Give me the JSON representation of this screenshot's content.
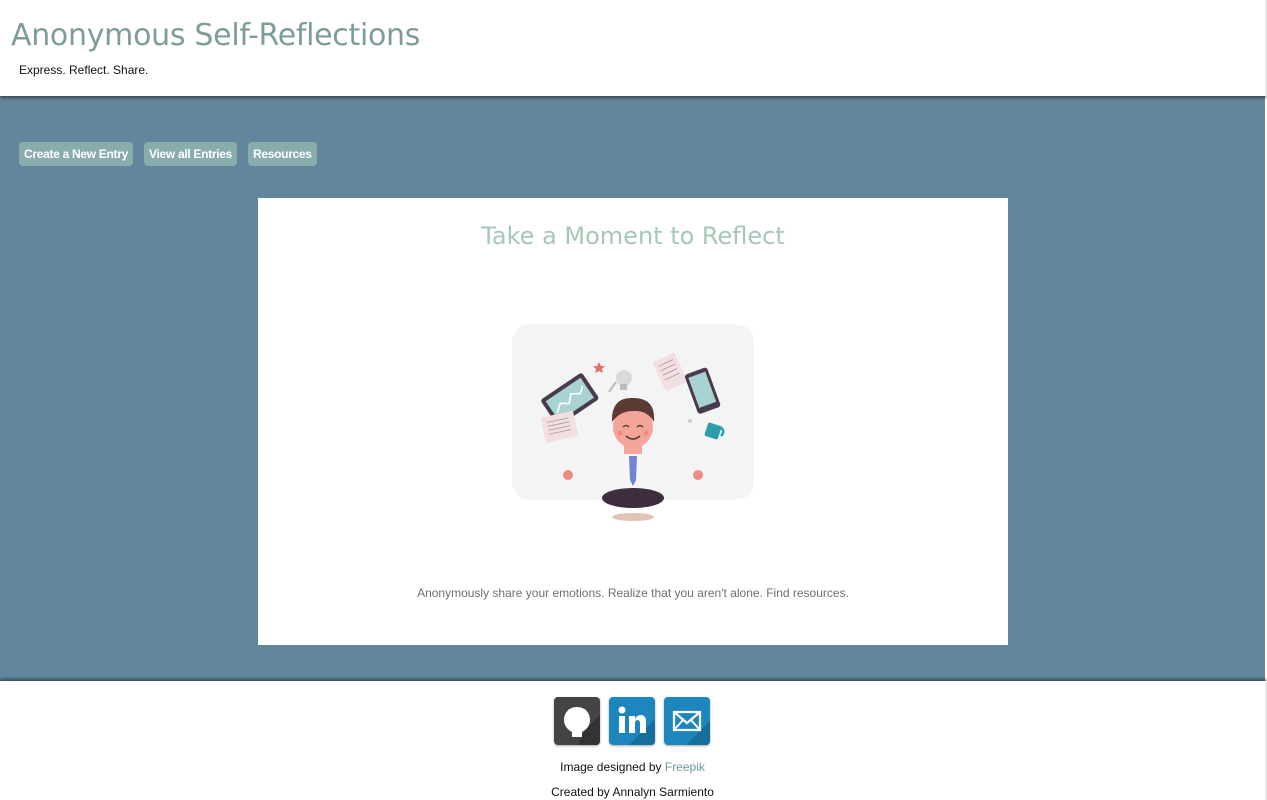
{
  "header": {
    "title": "Anonymous Self-Reflections",
    "tagline": "Express. Reflect. Share."
  },
  "nav": {
    "items": [
      {
        "label": "Create a New Entry"
      },
      {
        "label": "View all Entries"
      },
      {
        "label": "Resources"
      }
    ]
  },
  "card": {
    "title": "Take a Moment to Reflect",
    "illustration_icon": "meditating-businessman-illustration",
    "description": "Anonymously share your emotions. Realize that you aren't alone. Find resources."
  },
  "footer": {
    "socials": [
      {
        "icon": "github-icon"
      },
      {
        "icon": "linkedin-icon"
      },
      {
        "icon": "mail-icon"
      }
    ],
    "image_credit_prefix": "Image designed by ",
    "image_credit_link": "Freepik",
    "created_by": "Created by Annalyn Sarmiento"
  },
  "colors": {
    "title": "#7e9c99",
    "main_background": "#62869b",
    "nav_button": "#8aacad",
    "card_title": "#a6c8b7",
    "link": "#6b9a9a"
  }
}
